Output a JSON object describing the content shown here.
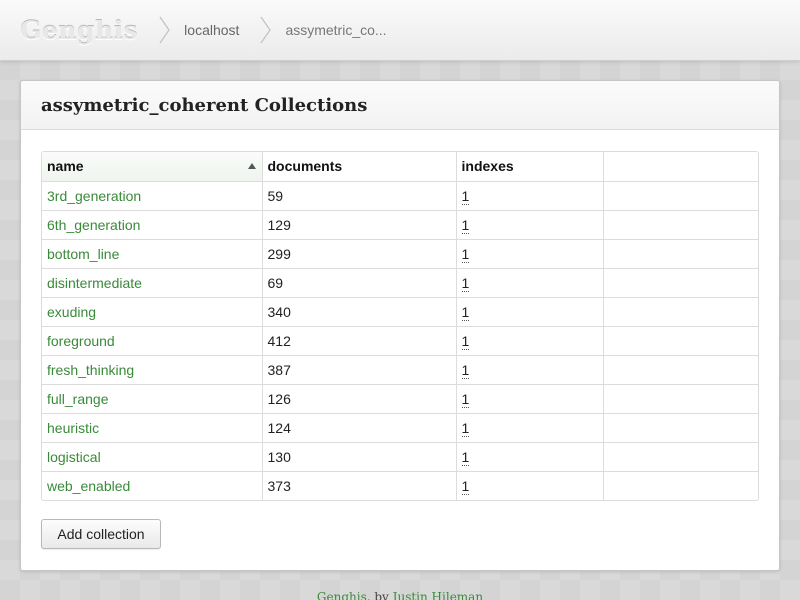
{
  "app": {
    "logo": "Genghis"
  },
  "breadcrumb": [
    {
      "label": "localhost"
    },
    {
      "label": "assymetric_co..."
    }
  ],
  "panel": {
    "title": "assymetric_coherent Collections"
  },
  "table": {
    "columns": [
      "name",
      "documents",
      "indexes",
      ""
    ],
    "rows": [
      {
        "name": "3rd_generation",
        "documents": "59",
        "indexes": "1"
      },
      {
        "name": "6th_generation",
        "documents": "129",
        "indexes": "1"
      },
      {
        "name": "bottom_line",
        "documents": "299",
        "indexes": "1"
      },
      {
        "name": "disintermediate",
        "documents": "69",
        "indexes": "1"
      },
      {
        "name": "exuding",
        "documents": "340",
        "indexes": "1"
      },
      {
        "name": "foreground",
        "documents": "412",
        "indexes": "1"
      },
      {
        "name": "fresh_thinking",
        "documents": "387",
        "indexes": "1"
      },
      {
        "name": "full_range",
        "documents": "126",
        "indexes": "1"
      },
      {
        "name": "heuristic",
        "documents": "124",
        "indexes": "1"
      },
      {
        "name": "logistical",
        "documents": "130",
        "indexes": "1"
      },
      {
        "name": "web_enabled",
        "documents": "373",
        "indexes": "1"
      }
    ]
  },
  "actions": {
    "add_collection": "Add collection"
  },
  "footer": {
    "app_link": "Genghis",
    "by": ", by ",
    "author_link": "Justin Hileman"
  },
  "colors": {
    "link_green": "#3a8a3a",
    "background": "#d9d9d9"
  },
  "icons": {
    "sort": "sort-up-icon",
    "separator": "chevron-right-icon"
  }
}
